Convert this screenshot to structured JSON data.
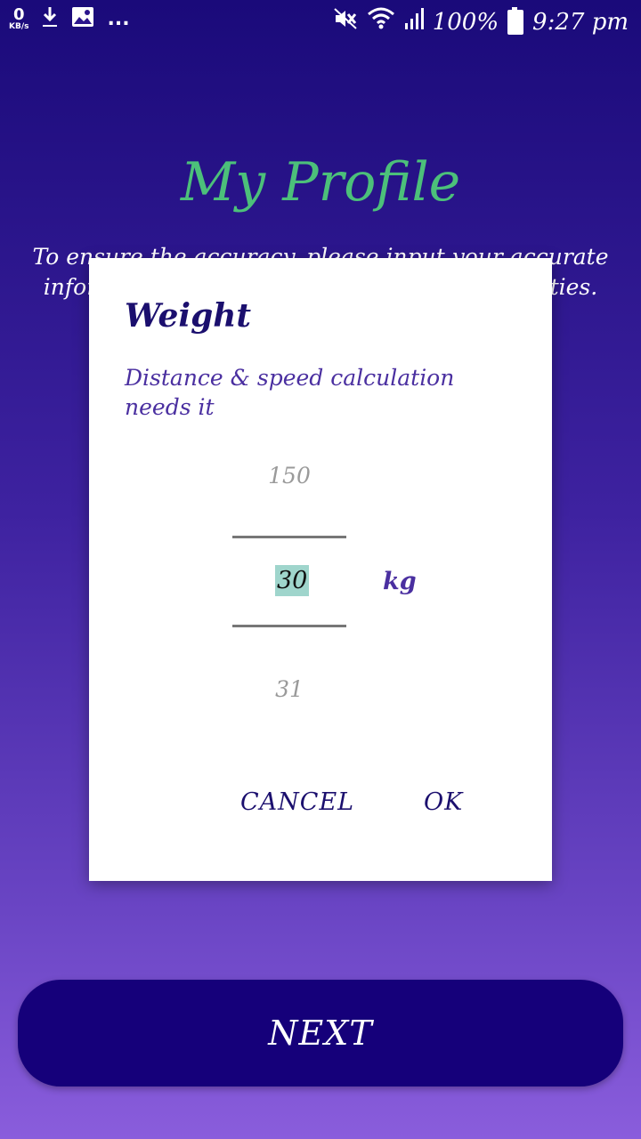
{
  "status_bar": {
    "speed_value": "0",
    "speed_unit": "KB/s",
    "overflow": "...",
    "battery": "100%",
    "time": "9:27 pm",
    "icons": [
      "download-icon",
      "image-icon",
      "mute-icon",
      "wifi-icon",
      "signal-icon",
      "battery-icon"
    ]
  },
  "page": {
    "title": "My Profile",
    "intro": "To ensure the accuracy, please input your accurate information. We won't share it with third parties."
  },
  "dialog": {
    "title": "Weight",
    "message": "Distance & speed calculation needs it",
    "picker": {
      "above": "150",
      "current": "30",
      "below": "31",
      "unit": "kg"
    },
    "cancel_label": "CANCEL",
    "ok_label": "OK"
  },
  "next_label": "NEXT",
  "colors": {
    "title": "#4cc07a",
    "next_button": "#15007a",
    "dialog_text": "#1b0f6e",
    "accent_text": "#4a2fa0",
    "picker_highlight": "#9fd5cc"
  }
}
